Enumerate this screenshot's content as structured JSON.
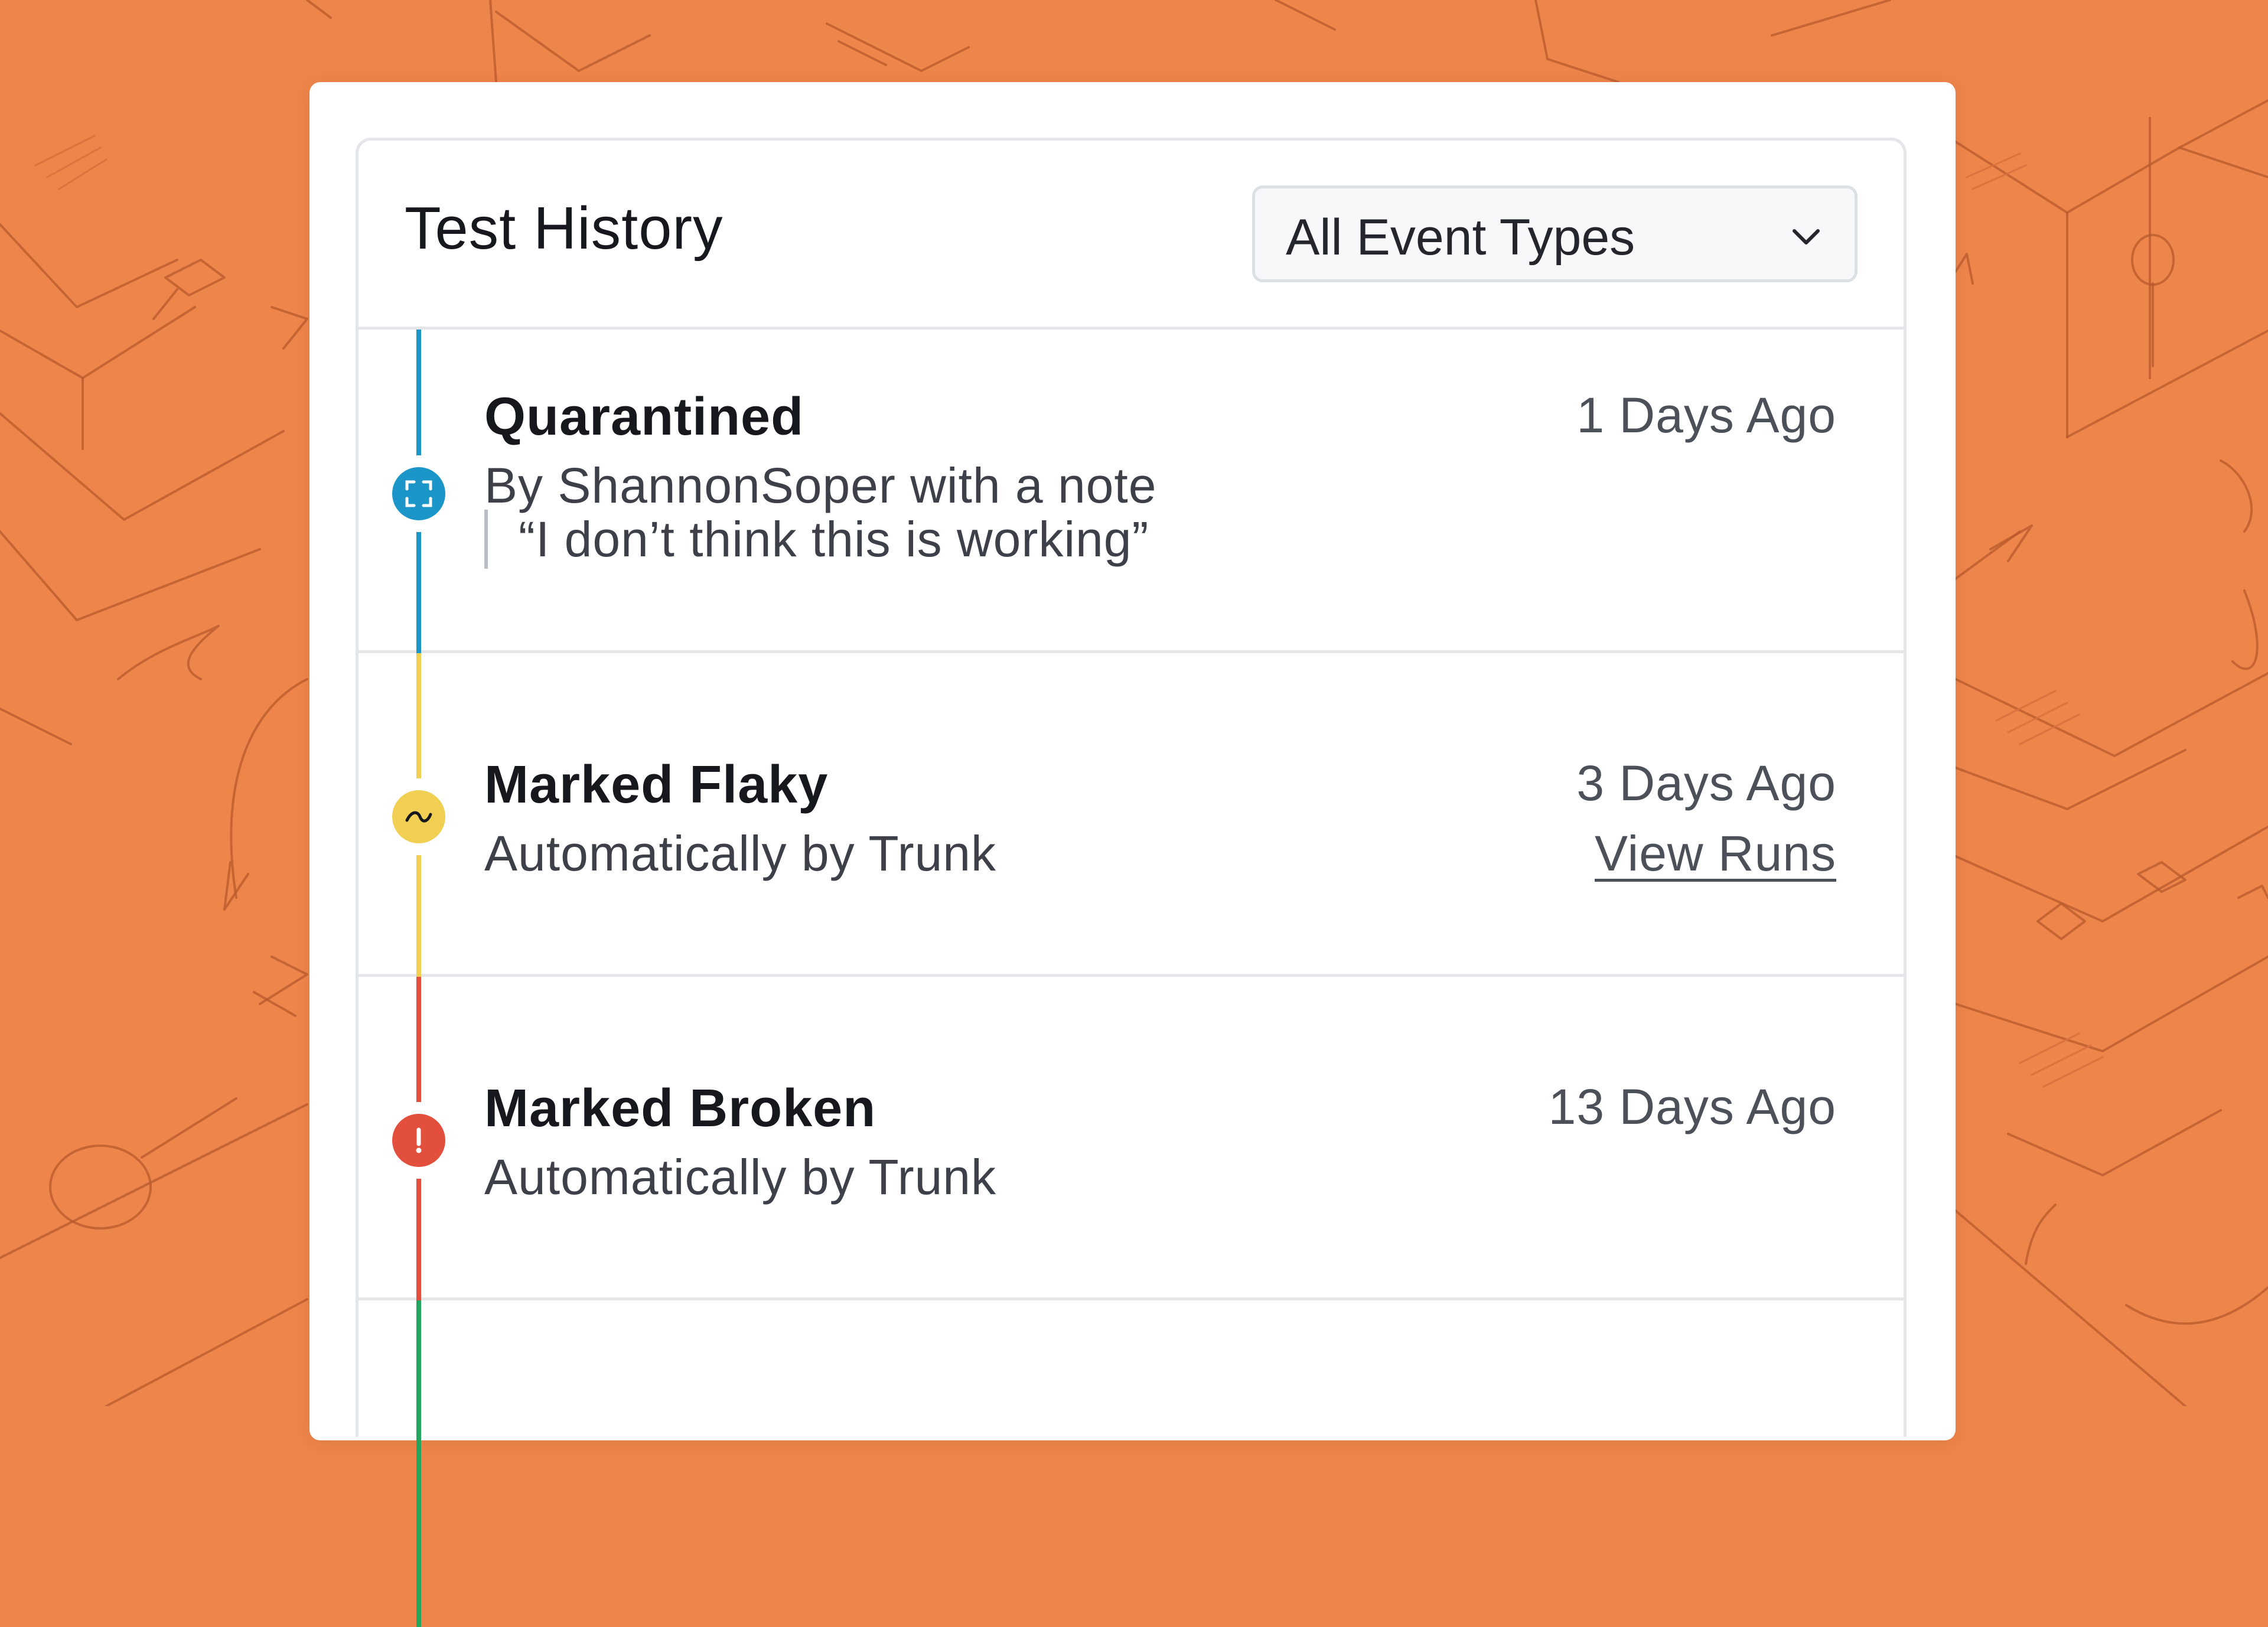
{
  "panel": {
    "title": "Test History",
    "filter": {
      "selected": "All Event Types",
      "icon": "chevron-down-icon"
    }
  },
  "events": [
    {
      "title": "Quarantined",
      "subtitle": "By ShannonSoper with a note",
      "note": "“I don’t think this is working”",
      "time": "1 Days Ago",
      "icon": "quarantine-icon",
      "color": "#1c95c9"
    },
    {
      "title": "Marked Flaky",
      "subtitle": "Automatically by Trunk",
      "time": "3 Days Ago",
      "link": "View Runs",
      "icon": "flaky-wave-icon",
      "color": "#f1cf53"
    },
    {
      "title": "Marked Broken",
      "subtitle": "Automatically by Trunk",
      "time": "13 Days Ago",
      "icon": "broken-alert-icon",
      "color": "#e34f3d"
    },
    {
      "color": "#22a55d"
    }
  ],
  "colors": {
    "background": "#ee854b",
    "card": "#ffffff",
    "border": "#e4e6ea"
  }
}
